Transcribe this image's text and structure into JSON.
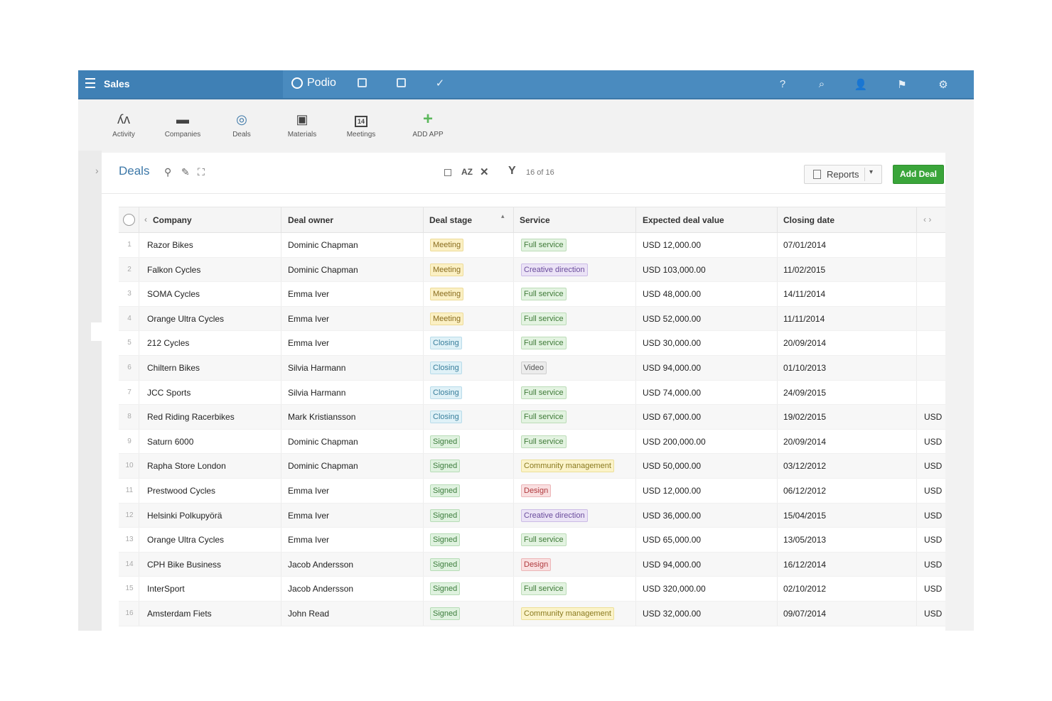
{
  "topbar": {
    "workspace": "Sales",
    "brand": "Podio",
    "icons": [
      "menu-icon",
      "stream-icon",
      "calendar-icon",
      "tasks-icon",
      "help-icon",
      "search-icon",
      "contacts-icon",
      "notifications-icon",
      "settings-icon"
    ]
  },
  "apps": [
    {
      "label": "Activity",
      "icon": "activity-icon"
    },
    {
      "label": "Companies",
      "icon": "companies-icon"
    },
    {
      "label": "Deals",
      "icon": "deals-icon"
    },
    {
      "label": "Materials",
      "icon": "materials-icon"
    },
    {
      "label": "Meetings",
      "icon": "meetings-icon",
      "date": "14"
    },
    {
      "label": "ADD APP",
      "icon": "plus-icon"
    }
  ],
  "panel": {
    "title": "Deals",
    "sort_label": "AZ",
    "filter_count": "16 of 16",
    "reports_label": "Reports",
    "add_deal_label": "Add Deal"
  },
  "columns": [
    "Company",
    "Deal owner",
    "Deal stage",
    "Service",
    "Expected deal value",
    "Closing date"
  ],
  "rows": [
    {
      "n": "1",
      "company": "Razor Bikes",
      "owner": "Dominic Chapman",
      "stage": "Meeting",
      "service": "Full service",
      "value": "USD 12,000.00",
      "date": "07/01/2014",
      "extra": ""
    },
    {
      "n": "2",
      "company": "Falkon Cycles",
      "owner": "Dominic Chapman",
      "stage": "Meeting",
      "service": "Creative direction",
      "value": "USD 103,000.00",
      "date": "11/02/2015",
      "extra": ""
    },
    {
      "n": "3",
      "company": "SOMA Cycles",
      "owner": "Emma Iver",
      "stage": "Meeting",
      "service": "Full service",
      "value": "USD 48,000.00",
      "date": "14/11/2014",
      "extra": ""
    },
    {
      "n": "4",
      "company": "Orange Ultra Cycles",
      "owner": "Emma Iver",
      "stage": "Meeting",
      "service": "Full service",
      "value": "USD 52,000.00",
      "date": "11/11/2014",
      "extra": ""
    },
    {
      "n": "5",
      "company": "212 Cycles",
      "owner": "Emma Iver",
      "stage": "Closing",
      "service": "Full service",
      "value": "USD 30,000.00",
      "date": "20/09/2014",
      "extra": ""
    },
    {
      "n": "6",
      "company": "Chiltern Bikes",
      "owner": "Silvia Harmann",
      "stage": "Closing",
      "service": "Video",
      "value": "USD 94,000.00",
      "date": "01/10/2013",
      "extra": ""
    },
    {
      "n": "7",
      "company": "JCC Sports",
      "owner": "Silvia Harmann",
      "stage": "Closing",
      "service": "Full service",
      "value": "USD 74,000.00",
      "date": "24/09/2015",
      "extra": ""
    },
    {
      "n": "8",
      "company": "Red Riding Racerbikes",
      "owner": "Mark Kristiansson",
      "stage": "Closing",
      "service": "Full service",
      "value": "USD 67,000.00",
      "date": "19/02/2015",
      "extra": "USD"
    },
    {
      "n": "9",
      "company": "Saturn 6000",
      "owner": "Dominic Chapman",
      "stage": "Signed",
      "service": "Full service",
      "value": "USD 200,000.00",
      "date": "20/09/2014",
      "extra": "USD"
    },
    {
      "n": "10",
      "company": "Rapha Store London",
      "owner": "Dominic Chapman",
      "stage": "Signed",
      "service": "Community management",
      "value": "USD 50,000.00",
      "date": "03/12/2012",
      "extra": "USD"
    },
    {
      "n": "11",
      "company": "Prestwood Cycles",
      "owner": "Emma Iver",
      "stage": "Signed",
      "service": "Design",
      "value": "USD 12,000.00",
      "date": "06/12/2012",
      "extra": "USD"
    },
    {
      "n": "12",
      "company": "Helsinki Polkupyörä",
      "owner": "Emma Iver",
      "stage": "Signed",
      "service": "Creative direction",
      "value": "USD 36,000.00",
      "date": "15/04/2015",
      "extra": "USD"
    },
    {
      "n": "13",
      "company": "Orange Ultra Cycles",
      "owner": "Emma Iver",
      "stage": "Signed",
      "service": "Full service",
      "value": "USD 65,000.00",
      "date": "13/05/2013",
      "extra": "USD"
    },
    {
      "n": "14",
      "company": "CPH Bike Business",
      "owner": "Jacob Andersson",
      "stage": "Signed",
      "service": "Design",
      "value": "USD 94,000.00",
      "date": "16/12/2014",
      "extra": "USD"
    },
    {
      "n": "15",
      "company": "InterSport",
      "owner": "Jacob Andersson",
      "stage": "Signed",
      "service": "Full service",
      "value": "USD 320,000.00",
      "date": "02/10/2012",
      "extra": "USD"
    },
    {
      "n": "16",
      "company": "Amsterdam Fiets",
      "owner": "John Read",
      "stage": "Signed",
      "service": "Community management",
      "value": "USD 32,000.00",
      "date": "09/07/2014",
      "extra": "USD"
    }
  ]
}
